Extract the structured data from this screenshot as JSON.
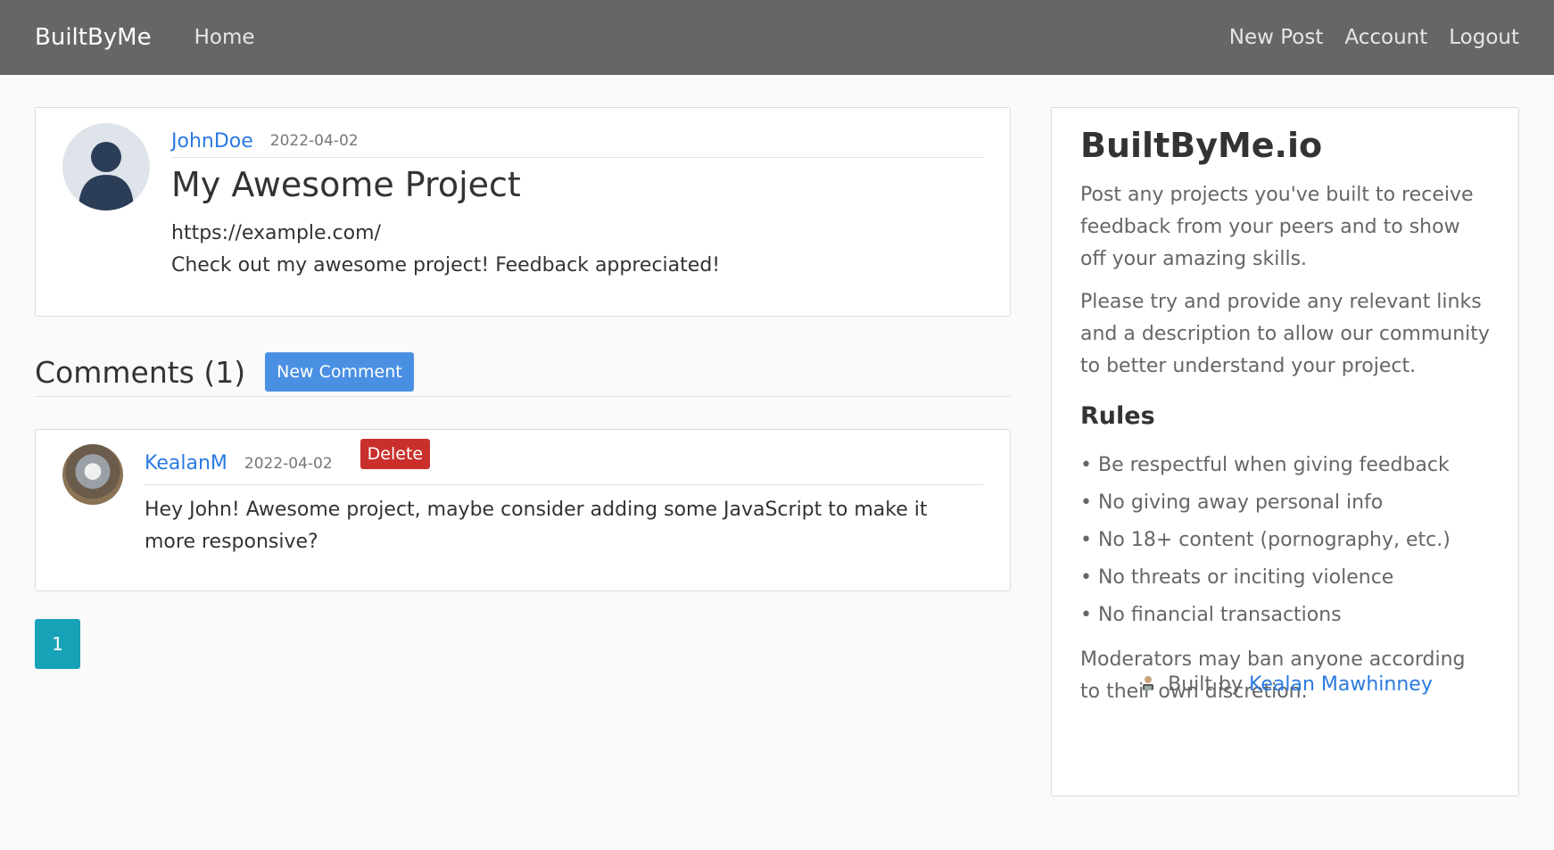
{
  "nav": {
    "brand": "BuiltByMe",
    "home": "Home",
    "new_post": "New Post",
    "account": "Account",
    "logout": "Logout"
  },
  "post": {
    "author": "JohnDoe",
    "date": "2022-04-02",
    "title": "My Awesome Project",
    "link": "https://example.com/",
    "body": "Check out my awesome project! Feedback appreciated!"
  },
  "comments": {
    "title": "Comments (1)",
    "new_button": "New Comment",
    "items": [
      {
        "author": "KealanM",
        "date": "2022-04-02",
        "delete_label": "Delete",
        "text": "Hey John! Awesome project, maybe consider adding some JavaScript to make it more responsive?"
      }
    ]
  },
  "pagination": {
    "current": "1"
  },
  "sidebar": {
    "title": "BuiltByMe.io",
    "intro": "Post any projects you've built to receive feedback from your peers and to show off your amazing skills.",
    "instructions": "Please try and provide any relevant links and a description to allow our community to better understand your project.",
    "rules_title": "Rules",
    "rules": [
      "• Be respectful when giving feedback",
      "• No giving away personal info",
      "• No 18+ content (pornography, etc.)",
      "• No threats or inciting violence",
      "• No financial transactions"
    ],
    "moderation": "Moderators may ban anyone according to their own discretion.",
    "built_by_prefix": "Built by",
    "built_by_name": "Kealan Mawhinney"
  }
}
